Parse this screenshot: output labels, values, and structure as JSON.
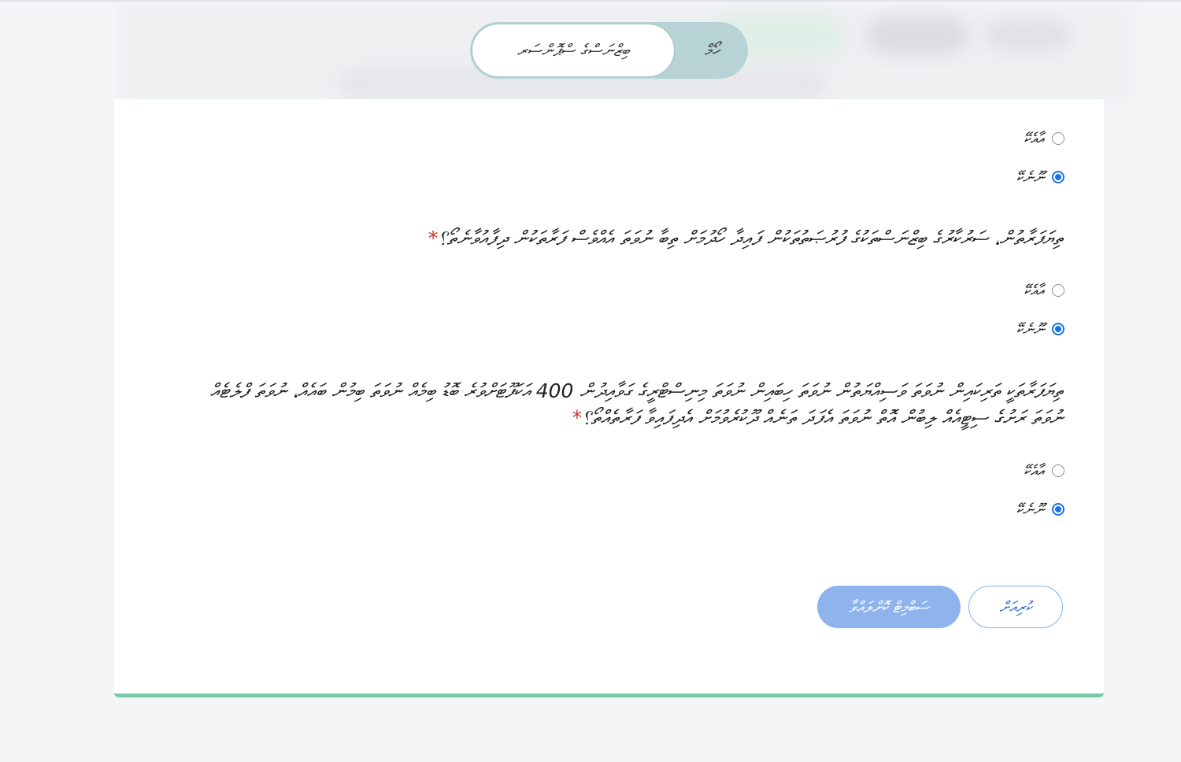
{
  "tabs": {
    "active_label": "ބިޒްނަސްގެ ސްޕޮންސަރ",
    "other_label": "ހޯމް"
  },
  "form": {
    "questions": [
      {
        "text": "",
        "required": "",
        "options": [
          {
            "label": "އާއެކޭ",
            "checked": false
          },
          {
            "label": "ނޫނެކޭ",
            "checked": true
          }
        ]
      },
      {
        "text": "ތިޔަފަރާތުން، ސަރުކާރުގެ ބިޒްނަސްތަކުގެ ފުރުޞަތުތަކުން ފައިދާ ހޯދުމަށް ތިބާ ނުވަތަ އެއްވެސް ފަރާތަކުން ދިފާއުވާނެތޯ؟",
        "required": "*",
        "options": [
          {
            "label": "އާއެކޭ",
            "checked": false
          },
          {
            "label": "ނޫނެކޭ",
            "checked": true
          }
        ]
      },
      {
        "text": "ތިޔަފަރާތަކީ ތަރިކައިން ނުވަތަ ވަސިއްޔަތުން ނުވަތަ ހިބައިން ނުވަތަ މިނިސްޓްރީގެ ގަވާއިދުން 400 އަކަފޫޓަށްވުރެ ބޮޑު ބިމެއް ނުވަތަ ބިމުން ބައެއް، ނުވަތަ ފްލެޓެއް ނުވަތަ ރަށުގެ ސިޓީއެއް ލިބުން އޮތް ނުވަތަ އެފަދަ ތަނެއް ދޫކުރެވުމަށް އެދިފައިވާ ފަރާތެއްތޯ؟",
        "required": "*",
        "options": [
          {
            "label": "އާއެކޭ",
            "checked": false
          },
          {
            "label": "ނޫނެކޭ",
            "checked": true
          }
        ]
      }
    ]
  },
  "buttons": {
    "back_label": "ކުރިއަށް",
    "submit_label": "ސަބްމިޓް ކޮށްލައްވާ"
  },
  "colors": {
    "accent": "#1a73e8",
    "success_border": "#74cba6",
    "required": "#d0342c"
  }
}
